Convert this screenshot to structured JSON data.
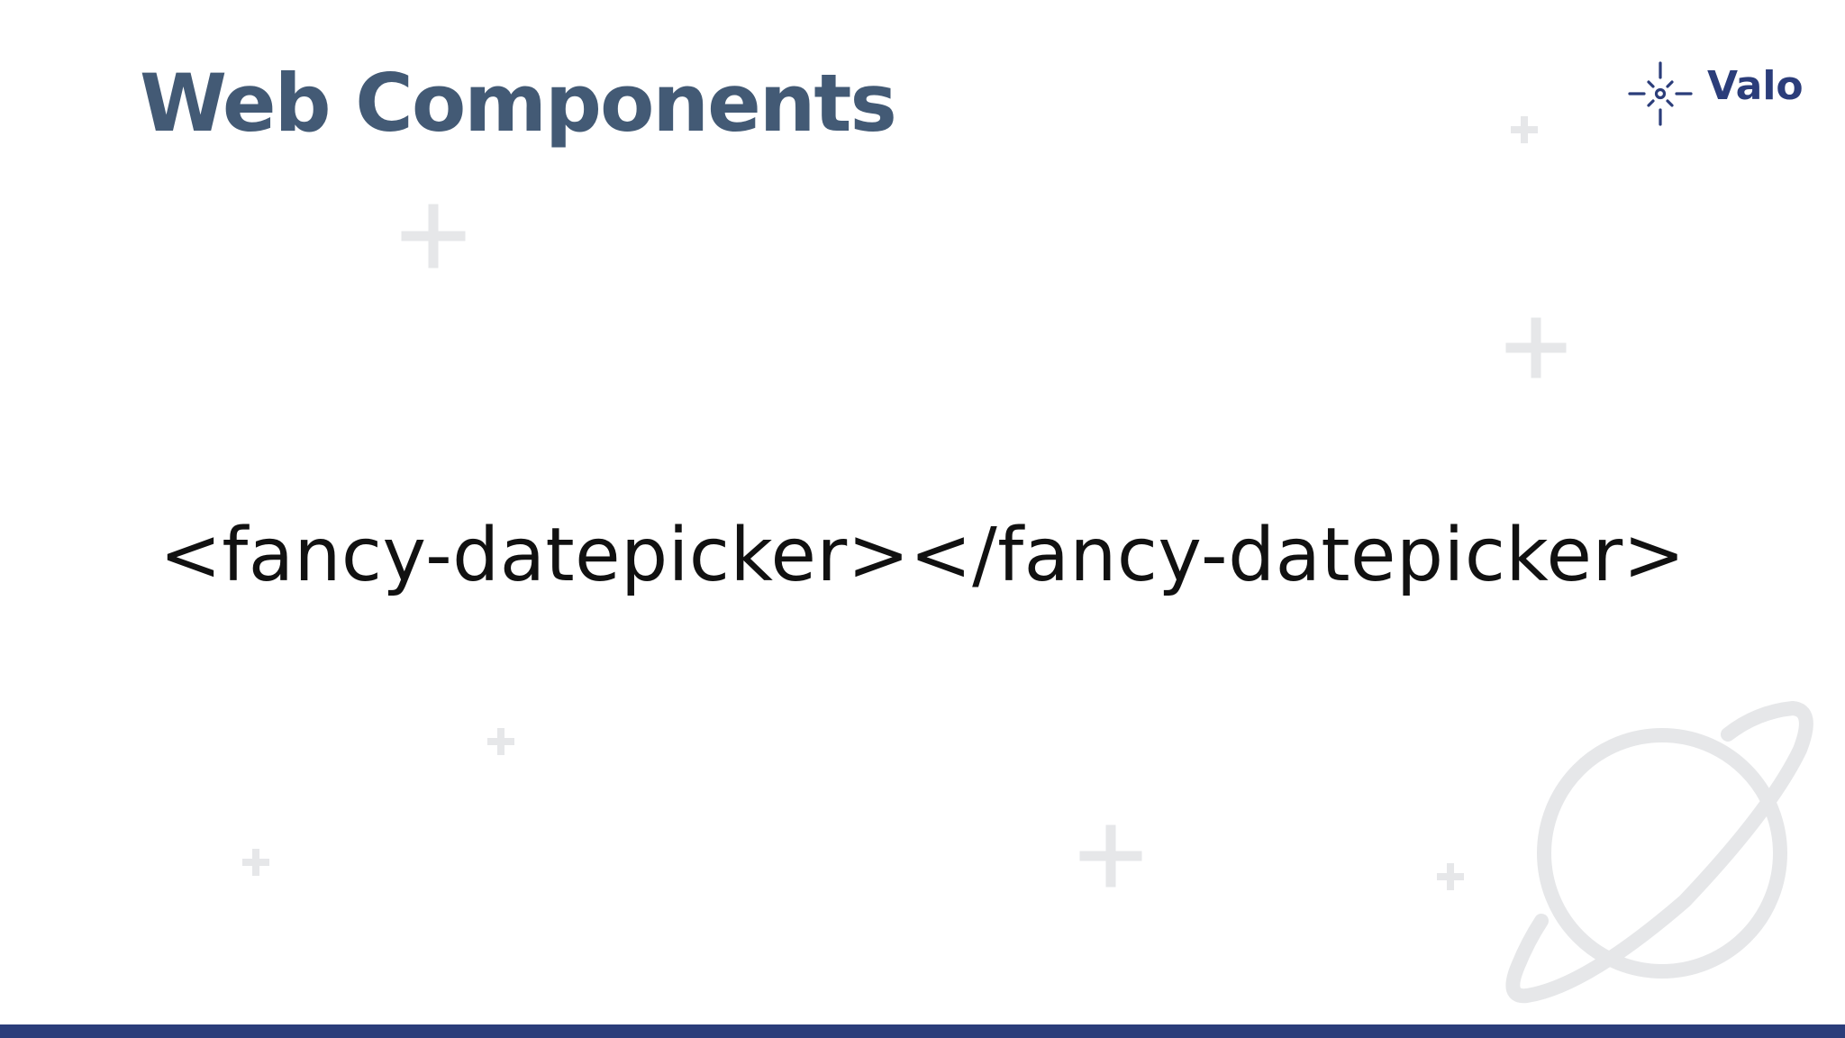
{
  "slide": {
    "title": "Web Components",
    "code_sample": "<fancy-datepicker></fancy-datepicker>"
  },
  "logo": {
    "text": "Valo",
    "icon": "sparkle-icon"
  },
  "decorations": {
    "plus_icon": "plus-icon",
    "planet_icon": "planet-icon"
  },
  "colors": {
    "title": "#435a75",
    "brand": "#2b3d7a",
    "decor": "#e6e7e9",
    "code": "#111111"
  }
}
